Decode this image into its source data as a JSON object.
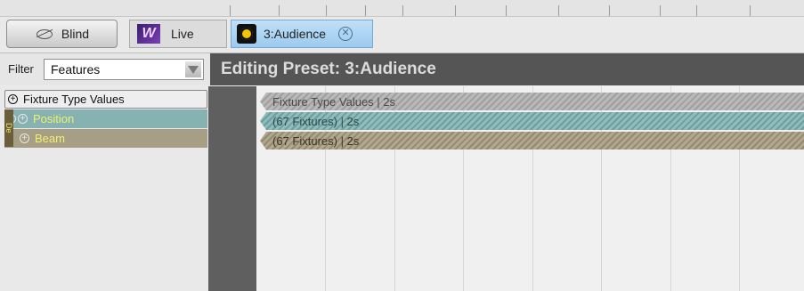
{
  "tabs": {
    "blind": {
      "label": "Blind",
      "icon": "eye-slash-icon"
    },
    "live": {
      "label": "Live",
      "icon": "live-w-icon"
    },
    "audience": {
      "label": "3:Audience",
      "icon": "sun-icon",
      "close_icon": "close-icon"
    }
  },
  "filter": {
    "label": "Filter",
    "value": "Features"
  },
  "editor": {
    "title": "Editing Preset: 3:Audience"
  },
  "tree": {
    "rows": [
      {
        "label": "Fixture Type Values"
      },
      {
        "label": "Position"
      },
      {
        "label": "Beam"
      }
    ],
    "deco_label": "De"
  },
  "timeline": {
    "bars": [
      {
        "label": "Fixture Type Values | 2s"
      },
      {
        "label": "(67 Fixtures) | 2s"
      },
      {
        "label": "(67 Fixtures) | 2s"
      }
    ]
  },
  "colors": {
    "position": "#87b2b2",
    "beam": "#a79e86",
    "active_tab": "#9ccaef",
    "header": "#555555"
  }
}
